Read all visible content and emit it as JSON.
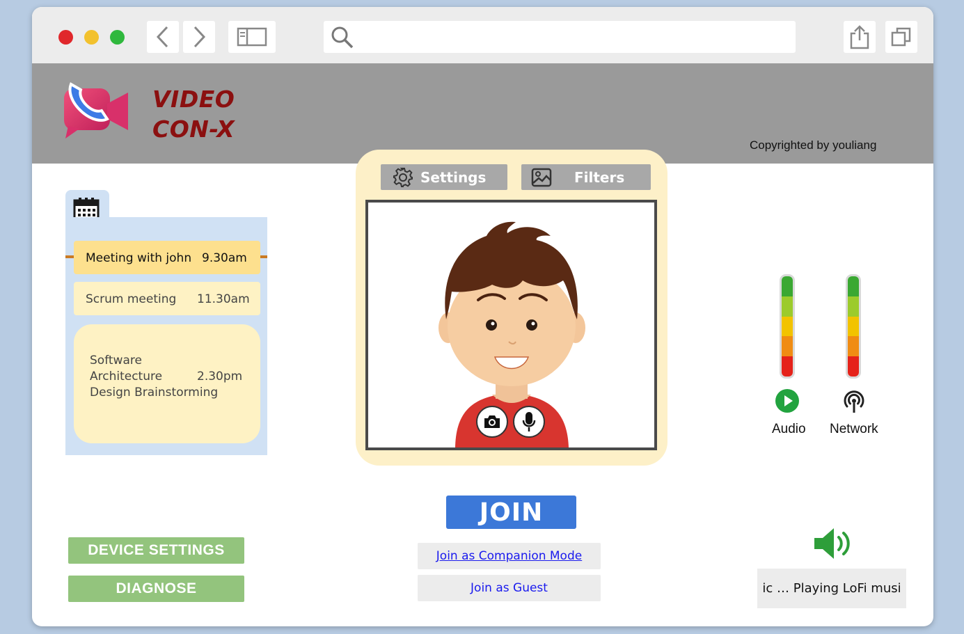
{
  "browser": {
    "traffic_lights": {
      "close": "#e0272b",
      "minimize": "#f2c12e",
      "maximize": "#2fb83d"
    },
    "icons": [
      "back-icon",
      "forward-icon",
      "sidebar-icon",
      "search-icon",
      "share-icon",
      "tabs-icon"
    ]
  },
  "header": {
    "app_title_line1": "VIDEO",
    "app_title_line2": "CON-X",
    "copyright": "Copyrighted by youliang",
    "logo_icon": "video-call-icon"
  },
  "calendar": {
    "icon": "calendar-icon",
    "events": [
      {
        "title": "Meeting with john",
        "time": "9.30am",
        "active": true
      },
      {
        "title": "Scrum meeting",
        "time": "11.30am",
        "active": false
      },
      {
        "title_lines": [
          "Software",
          "Architecture",
          "Design Brainstorming"
        ],
        "time": "2.30pm",
        "active": false
      }
    ]
  },
  "preview": {
    "settings_label": "Settings",
    "filters_label": "Filters",
    "camera_icon": "camera-icon",
    "mic_icon": "microphone-icon"
  },
  "status": {
    "audio_label": "Audio",
    "network_label": "Network",
    "meter_colors": [
      "#3aa832",
      "#9ccb2c",
      "#f2c300",
      "#f08c13",
      "#e5221a"
    ]
  },
  "actions": {
    "device_settings_label": "DEVICE SETTINGS",
    "diagnose_label": "DIAGNOSE",
    "join_label": "JOIN",
    "companion_label": "Join as Companion Mode",
    "guest_label": "Join as Guest"
  },
  "music": {
    "icon": "speaker-icon",
    "now_playing": "ic … Playing LoFi musi"
  }
}
